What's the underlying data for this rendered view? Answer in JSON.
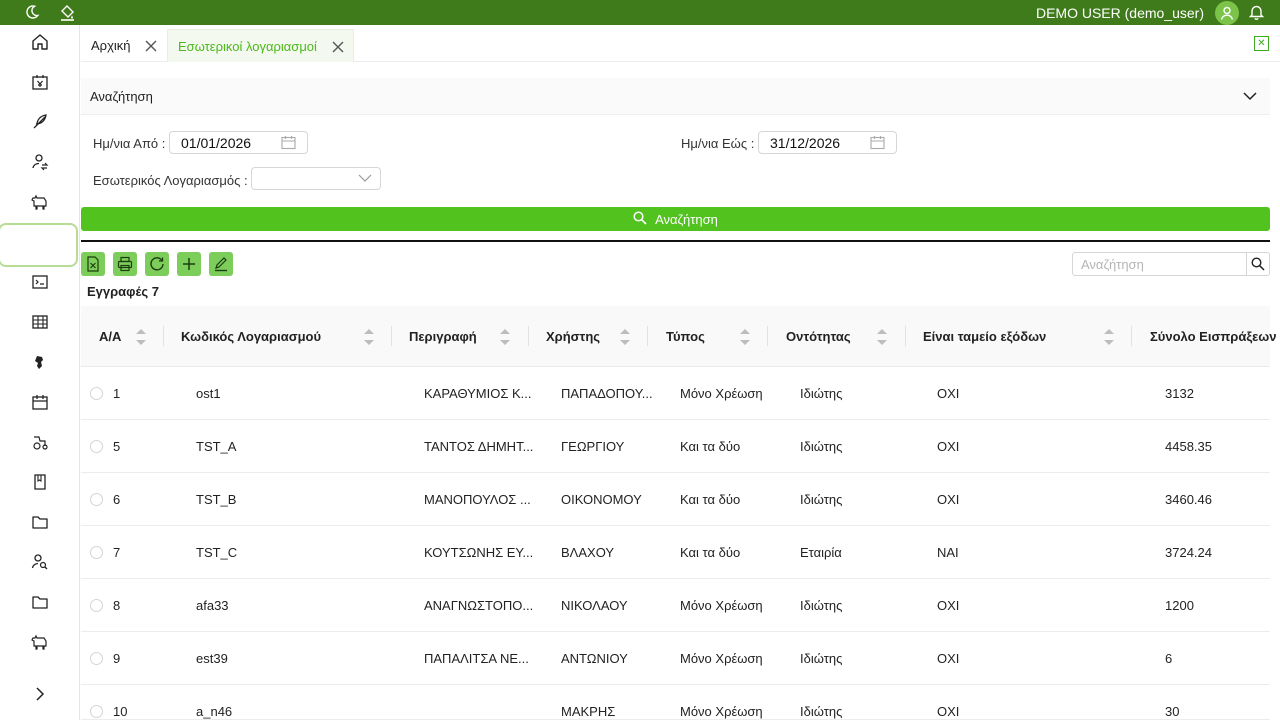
{
  "topbar": {
    "user_label": "DEMO USER (demo_user)",
    "icons": [
      "moon-icon",
      "paint-bucket-icon",
      "user-avatar-icon",
      "bell-icon"
    ],
    "bg_color": "#3f7a1b"
  },
  "sidebar": {
    "items": [
      "home-icon",
      "cash-register-icon",
      "feather-icon",
      "user-exchange-icon",
      "cow-icon",
      "blank-active",
      "terminal-icon",
      "table-icon",
      "map-icon",
      "calendar-icon",
      "tractor-icon",
      "notebook-icon",
      "folder-icon",
      "user-search-icon",
      "folder-icon",
      "cow-icon",
      "expand-icon"
    ]
  },
  "tabs": [
    {
      "label": "Αρχική",
      "active": false
    },
    {
      "label": "Εσωτερικοί λογαριασμοί",
      "active": true
    }
  ],
  "filter": {
    "title": "Αναζήτηση",
    "date_from_label": "Ημ/νια Από :",
    "date_from_value": "01/01/2026",
    "date_to_label": "Ημ/νια Εώς :",
    "date_to_value": "31/12/2026",
    "account_label": "Εσωτερικός Λογαριασμός :",
    "account_value": "",
    "search_button": "Αναζήτηση"
  },
  "toolbar": {
    "buttons": [
      "excel-icon",
      "print-icon",
      "refresh-icon",
      "add-icon",
      "edit-icon"
    ],
    "records_label": "Εγγραφές 7",
    "search_placeholder": "Αναζήτηση"
  },
  "table": {
    "columns": [
      "Α/Α",
      "Κωδικός Λογαριασμού",
      "Περιγραφή",
      "Χρήστης",
      "Τύπος",
      "Οντότητας",
      "Είναι ταμείο εξόδων",
      "Σύνολο Εισπράξεων"
    ],
    "rows": [
      [
        "1",
        "ost1",
        "ΚΑΡΑΘΥΜΙΟΣ Κ...",
        "ΠΑΠΑΔΟΠΟΥ...",
        "Μόνο Χρέωση",
        "Ιδιώτης",
        "ΟΧΙ",
        "3132"
      ],
      [
        "5",
        "TST_A",
        "ΤΑΝΤΟΣ ΔΗΜΗΤ...",
        "ΓΕΩΡΓΙΟΥ",
        "Και τα δύο",
        "Ιδιώτης",
        "ΟΧΙ",
        "4458.35"
      ],
      [
        "6",
        "TST_B",
        "ΜΑΝΟΠΟΥΛΟΣ ...",
        "ΟΙΚΟΝΟΜΟΥ",
        "Και τα δύο",
        "Ιδιώτης",
        "ΟΧΙ",
        "3460.46"
      ],
      [
        "7",
        "TST_C",
        "ΚΟΥΤΣΩΝΗΣ ΕΥ...",
        "ΒΛΑΧΟΥ",
        "Και τα δύο",
        "Εταιρία",
        "ΝΑΙ",
        "3724.24"
      ],
      [
        "8",
        "afa33",
        "ΑΝΑΓΝΩΣΤΟΠΟ...",
        "ΝΙΚΟΛΑΟΥ",
        "Μόνο Χρέωση",
        "Ιδιώτης",
        "ΟΧΙ",
        "1200"
      ],
      [
        "9",
        "est39",
        "ΠΑΠΑΛΙΤΣΑ ΝΕ...",
        "ΑΝΤΩΝΙΟΥ",
        "Μόνο Χρέωση",
        "Ιδιώτης",
        "ΟΧΙ",
        "6"
      ],
      [
        "10",
        "a_n46",
        "",
        "ΜΑΚΡΗΣ",
        "Μόνο Χρέωση",
        "Ιδιώτης",
        "ΟΧΙ",
        "30"
      ]
    ]
  },
  "colors": {
    "accent": "#52c21f",
    "accent_light": "#7ccd5a",
    "tab_active_text": "#4bb81c"
  }
}
